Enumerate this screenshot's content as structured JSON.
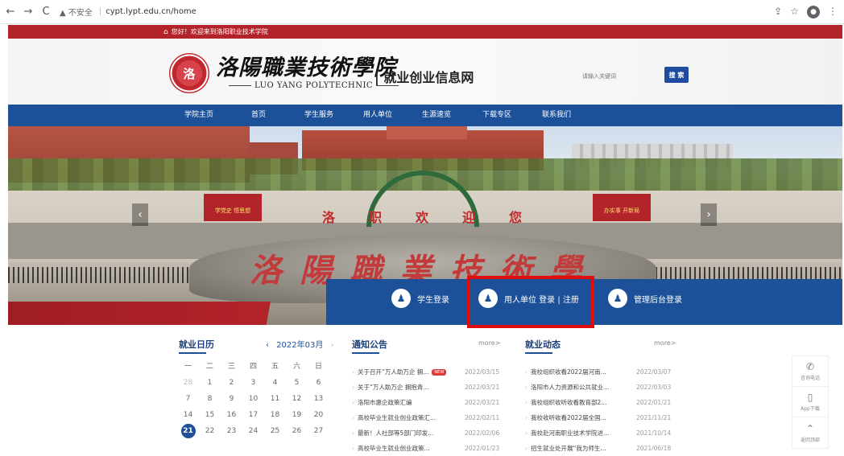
{
  "browser": {
    "back": "←",
    "forward": "→",
    "reload": "C",
    "security": "▲ 不安全",
    "url": "cypt.lypt.edu.cn/home"
  },
  "topbar": {
    "welcome": "您好！欢迎来到洛阳职业技术学院"
  },
  "header": {
    "logo_seal": "洛",
    "logo_cn": "洛陽職業技術學院",
    "logo_en": "LUO YANG  POLYTECHNIC",
    "site_title": "| 就业创业信息网",
    "search_placeholder": "请输入关键词",
    "search_button": "搜 索"
  },
  "nav": {
    "items": [
      "学院主页",
      "首页",
      "学生服务",
      "用人单位",
      "生源速览",
      "下载专区",
      "联系我们"
    ]
  },
  "banner": {
    "welcome": "洛职欢迎您",
    "rock_text": "洛陽職業技術學",
    "sign_left": "学党史 悟思想",
    "sign_right": "办实事 开新局",
    "prev": "‹",
    "next": "›"
  },
  "login": {
    "student": "学生登录",
    "employer": "用人单位 登录 | 注册",
    "admin": "管理后台登录"
  },
  "calendar": {
    "title": "就业日历",
    "month": "2022年03月",
    "weekdays": [
      "一",
      "二",
      "三",
      "四",
      "五",
      "六",
      "日"
    ],
    "days": [
      [
        "28",
        "1",
        "2",
        "3",
        "4",
        "5",
        "6"
      ],
      [
        "7",
        "8",
        "9",
        "10",
        "11",
        "12",
        "13"
      ],
      [
        "14",
        "15",
        "16",
        "17",
        "18",
        "19",
        "20"
      ],
      [
        "21",
        "22",
        "23",
        "24",
        "25",
        "26",
        "27"
      ]
    ],
    "today": "21"
  },
  "notices": {
    "title": "通知公告",
    "more": "more>",
    "items": [
      {
        "title": "关于召开“万人助万企 拥...",
        "date": "2022/03/15",
        "new": "NEW"
      },
      {
        "title": "关于“万人助万企 拥抱青...",
        "date": "2022/03/21"
      },
      {
        "title": "洛阳市惠企政策汇编",
        "date": "2022/03/21"
      },
      {
        "title": "高校毕业生就业创业政策汇...",
        "date": "2022/02/11"
      },
      {
        "title": "最新！人社部等5部门印发...",
        "date": "2022/02/06"
      },
      {
        "title": "高校毕业生就业创业政策...",
        "date": "2022/01/23"
      }
    ]
  },
  "news": {
    "title": "就业动态",
    "more": "more>",
    "items": [
      {
        "title": "我校组织收看2022届河南...",
        "date": "2022/03/07"
      },
      {
        "title": "洛阳市人力资源和公共就业...",
        "date": "2022/03/03"
      },
      {
        "title": "我校组织收听收看教育部2...",
        "date": "2022/01/21"
      },
      {
        "title": "我校收听收看2022届全国...",
        "date": "2021/11/21"
      },
      {
        "title": "我校赴河南职业技术学院进...",
        "date": "2021/10/14"
      },
      {
        "title": "招生就业处开展“我为师生...",
        "date": "2021/06/18"
      }
    ]
  },
  "side": {
    "phone": "咨询电话",
    "app": "App下载",
    "top": "返回顶部"
  }
}
